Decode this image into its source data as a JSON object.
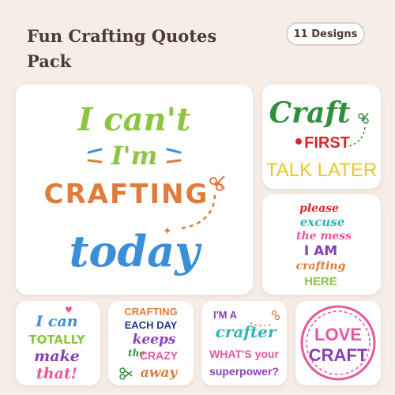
{
  "header": {
    "title": "Fun Crafting Quotes Pack",
    "badge": "11 Designs"
  },
  "designs": {
    "main": {
      "l1": "I can't",
      "l2": "I'm",
      "l3": "CRAFTING",
      "l4": "today"
    },
    "craft_first": {
      "l1": "Craft",
      "l2": "FIRST",
      "l3": "TALK LATER"
    },
    "please_excuse": {
      "l1": "please",
      "l2": "excuse",
      "l3": "the mess",
      "l4": "I AM",
      "l5": "crafting",
      "l6": "HERE"
    },
    "i_can_totally": {
      "l1": "I can",
      "l2": "TOTALLY",
      "l3": "make",
      "l4": "that!"
    },
    "crafting_each_day": {
      "l1": "CRAFTING",
      "l2": "EACH DAY",
      "l3": "keeps",
      "l4": "the",
      "l5": "CRAZY",
      "l6": "away"
    },
    "superpower": {
      "l1": "I'M A",
      "l2": "crafter",
      "l3": "WHAT'S your",
      "l4": "superpower?"
    },
    "love_craft": {
      "l1": "LOVE",
      "l2": "CRAFT"
    }
  },
  "colors": {
    "background": "#f6ede6",
    "title": "#4a3a33",
    "green": "#8cc63f",
    "orange": "#e07b39",
    "blue": "#3b8fd9",
    "pink": "#e8569a",
    "purple": "#8b3fb5",
    "red": "#d9262b",
    "yellow": "#e9c62b"
  }
}
